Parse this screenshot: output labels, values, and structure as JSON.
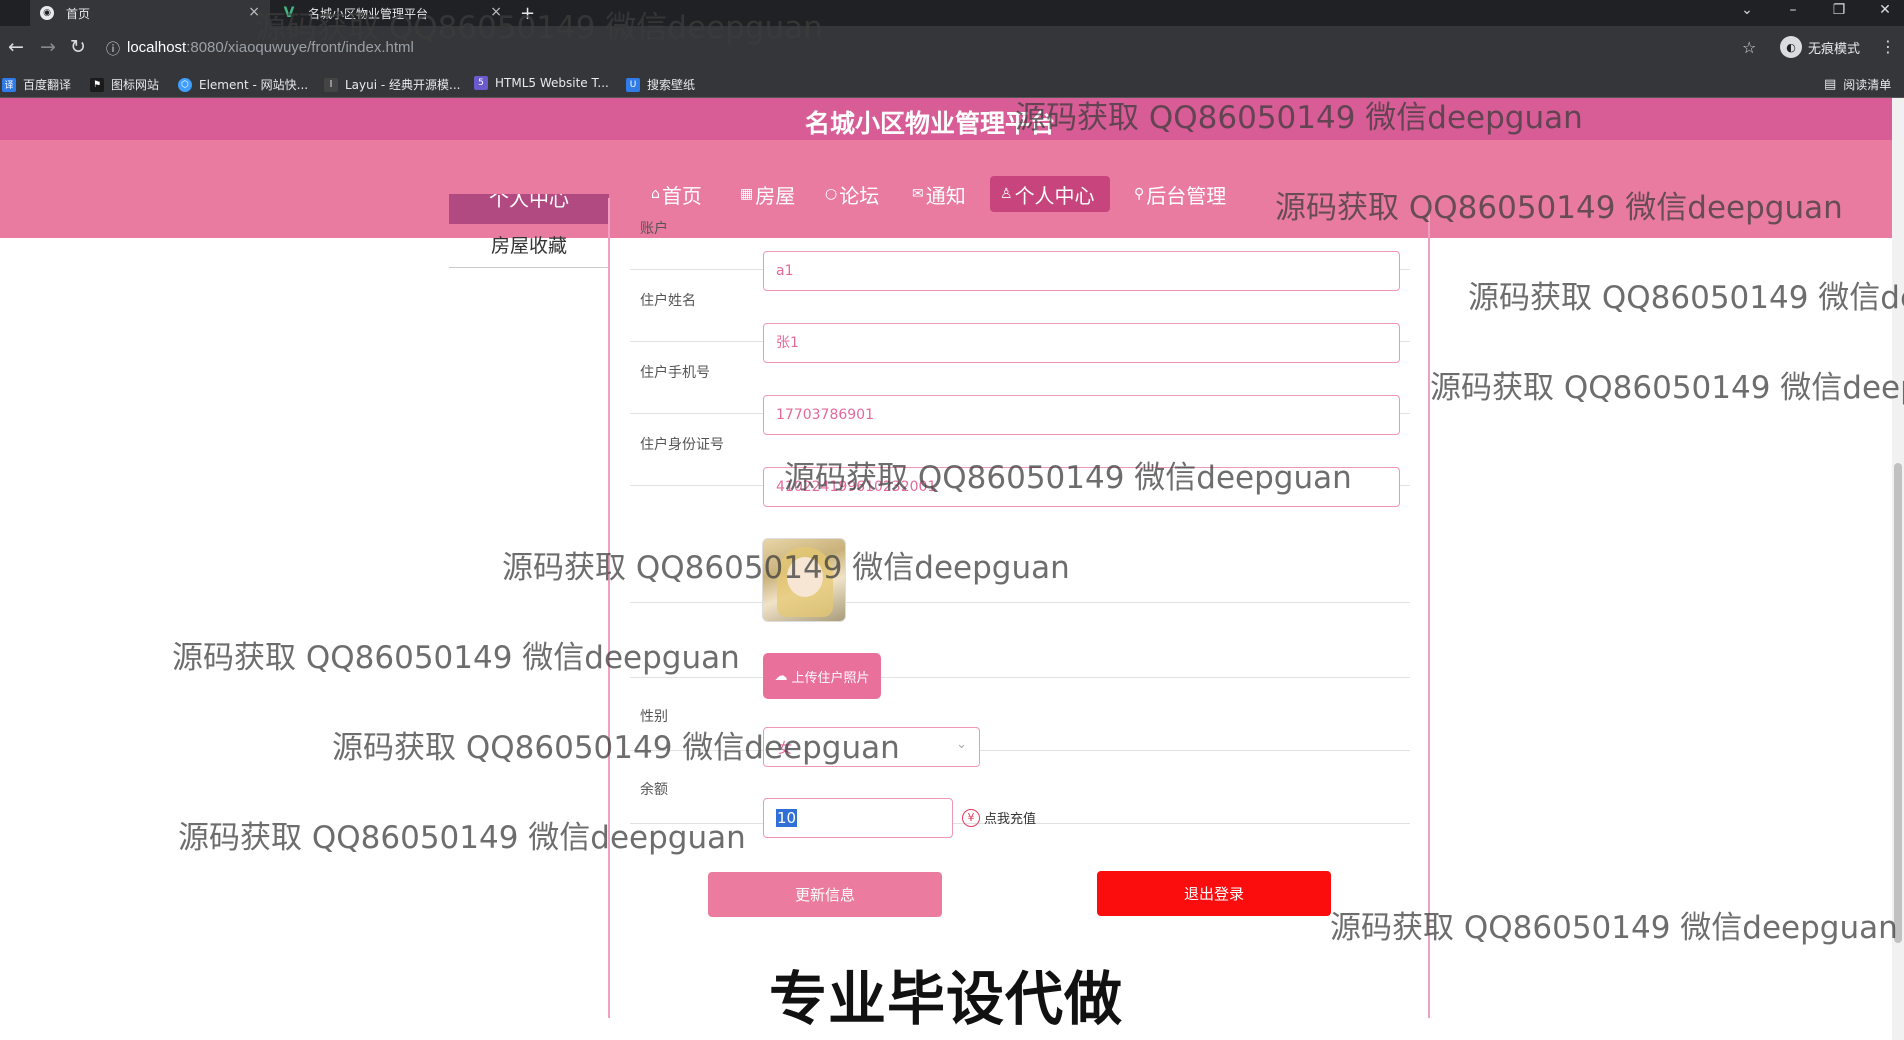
{
  "browser": {
    "tabs": [
      {
        "title": "首页",
        "active": true
      },
      {
        "title": "名城小区物业管理平台",
        "active": false
      }
    ],
    "new_tab_glyph": "+",
    "url_host": "localhost",
    "url_path": ":8080/xiaoquwuye/front/index.html",
    "incognito_label": "无痕模式",
    "reading_list_label": "阅读清单",
    "bookmarks": [
      {
        "label": "百度翻译",
        "icon": "translate-icon",
        "color": "#2f7be8"
      },
      {
        "label": "图标网站",
        "icon": "flag-icon",
        "color": "#222222"
      },
      {
        "label": "Element - 网站快...",
        "icon": "element-icon",
        "color": "#409eff"
      },
      {
        "label": "Layui - 经典开源模...",
        "icon": "layui-icon",
        "color": "#333333"
      },
      {
        "label": "HTML5 Website T...",
        "icon": "html5-icon",
        "color": "#6a5acd"
      },
      {
        "label": "搜索壁纸",
        "icon": "wallpaper-icon",
        "color": "#2f7be8"
      }
    ]
  },
  "site": {
    "title": "名城小区物业管理平台",
    "nav": [
      {
        "label": "首页",
        "icon": "home-icon",
        "active": false
      },
      {
        "label": "房屋",
        "icon": "building-icon",
        "active": false
      },
      {
        "label": "论坛",
        "icon": "forum-icon",
        "active": false
      },
      {
        "label": "通知",
        "icon": "mail-icon",
        "active": false
      },
      {
        "label": "个人中心",
        "icon": "user-icon",
        "active": true
      },
      {
        "label": "后台管理",
        "icon": "link-icon",
        "active": false
      }
    ]
  },
  "sidebar": {
    "active_label": "个人中心",
    "items": [
      {
        "label": "房屋收藏"
      }
    ]
  },
  "form": {
    "account": {
      "label": "账户",
      "value": "a1"
    },
    "name": {
      "label": "住户姓名",
      "value": "张1"
    },
    "phone": {
      "label": "住户手机号",
      "value": "17703786901"
    },
    "id_card": {
      "label": "住户身份证号",
      "value": "410224199610232001"
    },
    "upload_label": "上传住户照片",
    "gender": {
      "label": "性别",
      "value": "女"
    },
    "balance": {
      "label": "余额",
      "value": "10"
    },
    "recharge_label": "点我充值",
    "update_label": "更新信息",
    "logout_label": "退出登录"
  },
  "colors": {
    "header": "#d85c95",
    "navbar": "#ea7ba0",
    "nav_active": "#c7447d",
    "logout": "#fc0d0d",
    "update": "#eb7ca0"
  },
  "watermark_text": "源码获取 QQ86050149 微信deepguan",
  "caption": "专业毕设代做"
}
